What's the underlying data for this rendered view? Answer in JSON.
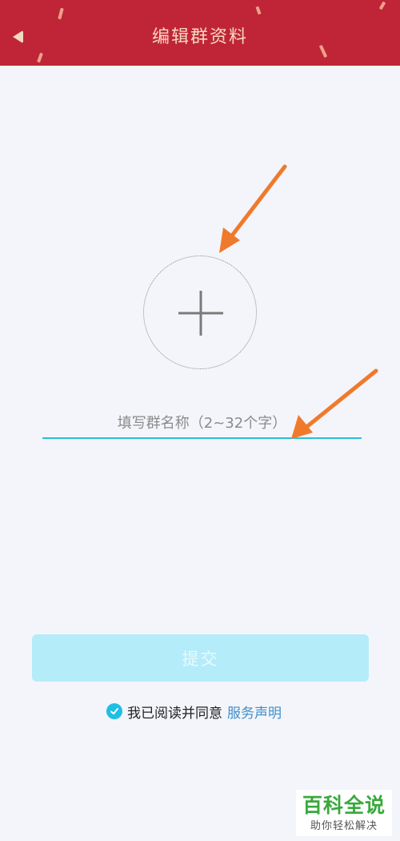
{
  "header": {
    "title": "编辑群资料",
    "back_icon": "back-arrow-icon"
  },
  "avatar": {
    "icon": "plus-icon"
  },
  "group_name": {
    "value": "",
    "placeholder": "填写群名称（2~32个字）"
  },
  "submit": {
    "label": "提交"
  },
  "agreement": {
    "checked": true,
    "text": "我已阅读并同意",
    "link": "服务声明"
  },
  "watermark": {
    "title": "百科全说",
    "subtitle": "助你轻松解决"
  },
  "colors": {
    "header_bg": "#bf2537",
    "title_text": "#f6d7c4",
    "accent_cyan": "#29bfd9",
    "submit_bg": "#b4ecfa",
    "link": "#3f8ec8",
    "annotation_arrow": "#f07a2c",
    "watermark_green": "#39a83b"
  }
}
